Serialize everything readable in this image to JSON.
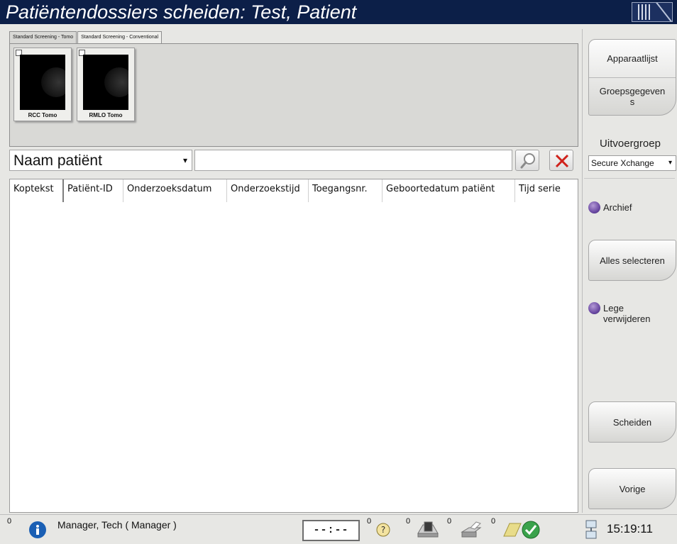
{
  "window": {
    "title": "Patiëntendossiers scheiden: Test, Patient"
  },
  "thumbnails": {
    "tabs": [
      "Standard Screening - Tomo",
      "Standard Screening - Conventional"
    ],
    "items": [
      {
        "label": "RCC Tomo"
      },
      {
        "label": "RMLO Tomo"
      }
    ]
  },
  "search": {
    "field_selected": "Naam patiënt",
    "query_value": "",
    "search_icon": "magnifier-icon",
    "clear_icon": "red-x-icon"
  },
  "table": {
    "columns": [
      "Koptekst",
      "Patiënt-ID",
      "Onderzoeksdatum",
      "Onderzoekstijd",
      "Toegangsnr.",
      "Geboortedatum patiënt",
      "Tijd serie"
    ],
    "rows": []
  },
  "sidebar": {
    "device_list_label": "Apparaatlijst",
    "group_data_label": "Groepsgegeven\ns",
    "output_group_label": "Uitvoergroep",
    "output_group_value": "Secure Xchange",
    "archive_label": "Archief",
    "select_all_label": "Alles selecteren",
    "delete_empty_label": "Lege\nverwijderen",
    "separate_label": "Scheiden",
    "back_label": "Vorige"
  },
  "statusbar": {
    "info_count": "0",
    "user": "Manager, Tech ( Manager )",
    "timer": "--:--",
    "help_count": "0",
    "scan_count": "0",
    "print_count": "0",
    "note_count": "0",
    "clock": "15:19:11"
  },
  "colors": {
    "titlebar": "#0c1f48",
    "radio": "#6b4aa3",
    "clear": "#d0211b"
  }
}
